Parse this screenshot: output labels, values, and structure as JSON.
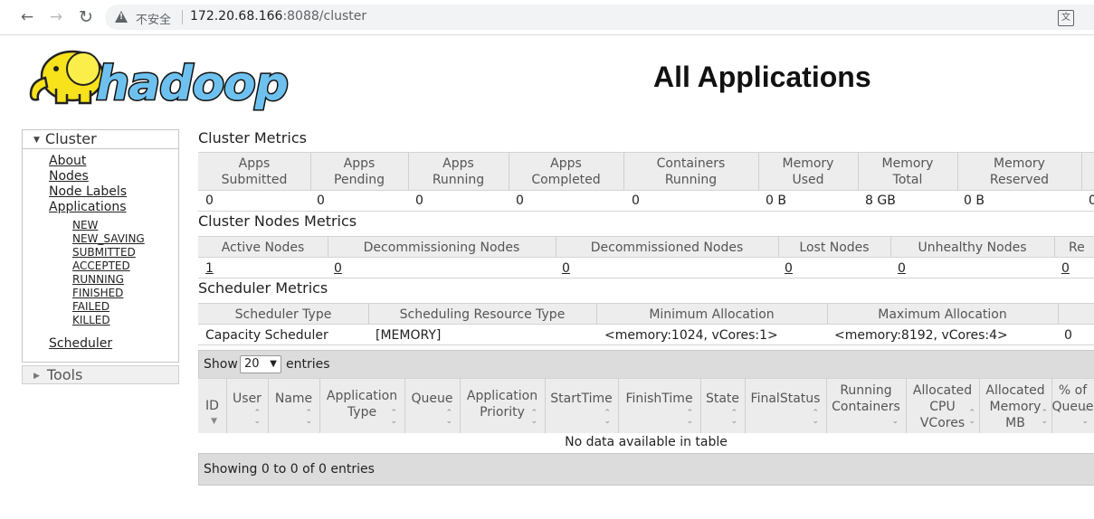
{
  "browser": {
    "insecure_label": "不安全",
    "url_host": "172.20.68.166",
    "url_path": ":8088/cluster"
  },
  "header": {
    "title": "All Applications",
    "logo_text": "hadoop"
  },
  "sidebar": {
    "cluster_label": "Cluster",
    "links": [
      "About",
      "Nodes",
      "Node Labels",
      "Applications"
    ],
    "app_states": [
      "NEW",
      "NEW_SAVING",
      "SUBMITTED",
      "ACCEPTED",
      "RUNNING",
      "FINISHED",
      "FAILED",
      "KILLED"
    ],
    "scheduler_label": "Scheduler",
    "tools_label": "Tools"
  },
  "cluster_metrics": {
    "title": "Cluster Metrics",
    "headers": [
      [
        "Apps",
        "Submitted"
      ],
      [
        "Apps",
        "Pending"
      ],
      [
        "Apps",
        "Running"
      ],
      [
        "Apps",
        "Completed"
      ],
      [
        "Containers",
        "Running"
      ],
      [
        "Memory",
        "Used"
      ],
      [
        "Memory",
        "Total"
      ],
      [
        "Memory",
        "Reserved"
      ]
    ],
    "values": [
      "0",
      "0",
      "0",
      "0",
      "0",
      "0 B",
      "8 GB",
      "0 B",
      "0"
    ]
  },
  "node_metrics": {
    "title": "Cluster Nodes Metrics",
    "headers": [
      "Active Nodes",
      "Decommissioning Nodes",
      "Decommissioned Nodes",
      "Lost Nodes",
      "Unhealthy Nodes",
      "Re"
    ],
    "values": [
      "1",
      "0",
      "0",
      "0",
      "0",
      "0"
    ]
  },
  "scheduler_metrics": {
    "title": "Scheduler Metrics",
    "headers": [
      "Scheduler Type",
      "Scheduling Resource Type",
      "Minimum Allocation",
      "Maximum Allocation"
    ],
    "values": [
      "Capacity Scheduler",
      "[MEMORY]",
      "<memory:1024, vCores:1>",
      "<memory:8192, vCores:4>",
      "0"
    ]
  },
  "apps_table": {
    "show_label": "Show",
    "entries_label": "entries",
    "page_size": "20",
    "columns": [
      [
        "ID"
      ],
      [
        "User"
      ],
      [
        "Name"
      ],
      [
        "Application",
        "Type"
      ],
      [
        "Queue"
      ],
      [
        "Application",
        "Priority"
      ],
      [
        "StartTime"
      ],
      [
        "FinishTime"
      ],
      [
        "State"
      ],
      [
        "FinalStatus"
      ],
      [
        "Running",
        "Containers"
      ],
      [
        "Allocated",
        "CPU",
        "VCores"
      ],
      [
        "Allocated",
        "Memory",
        "MB"
      ],
      [
        "% of",
        "Queue"
      ]
    ],
    "empty_message": "No data available in table",
    "footer_info": "Showing 0 to 0 of 0 entries"
  }
}
